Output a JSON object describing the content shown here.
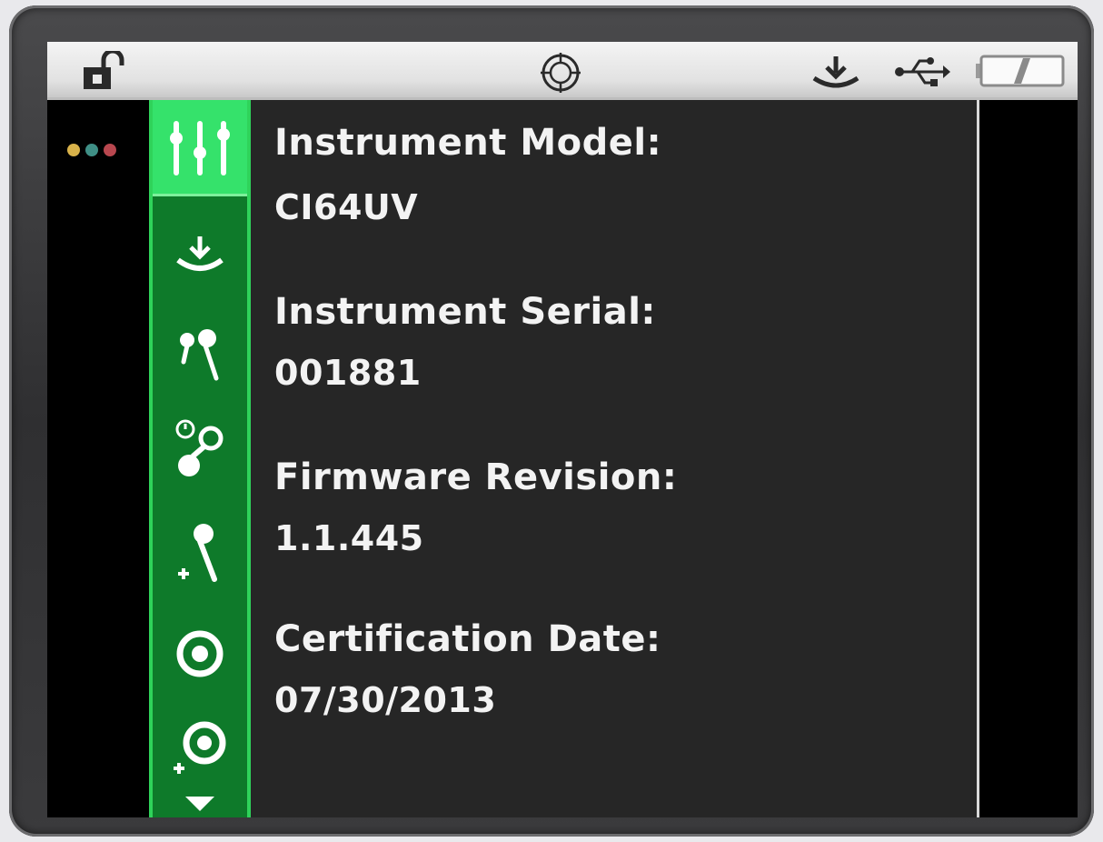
{
  "statusbar": {
    "icons": [
      "unlock-icon",
      "target-icon",
      "download-icon",
      "usb-icon",
      "battery-icon"
    ]
  },
  "indicator_dots": [
    "#d8b24a",
    "#3f8f86",
    "#b8474f"
  ],
  "sidebar": {
    "accent_color": "#0e7a2a",
    "active_color": "#35e26b",
    "items": [
      {
        "icon": "sliders-icon",
        "active": true
      },
      {
        "icon": "download-icon",
        "active": false
      },
      {
        "icon": "probes-icon",
        "active": false
      },
      {
        "icon": "probe-timer-icon",
        "active": false
      },
      {
        "icon": "add-probe-icon",
        "active": false
      },
      {
        "icon": "target-circle-icon",
        "active": false
      },
      {
        "icon": "add-target-icon",
        "active": false
      },
      {
        "icon": "scroll-down-icon",
        "active": false
      }
    ]
  },
  "info": {
    "fields": [
      {
        "label": "Instrument Model:",
        "value": "CI64UV"
      },
      {
        "label": "Instrument Serial:",
        "value": "001881"
      },
      {
        "label": "Firmware Revision:",
        "value": "1.1.445"
      },
      {
        "label": "Certification Date:",
        "value": "07/30/2013"
      }
    ]
  }
}
